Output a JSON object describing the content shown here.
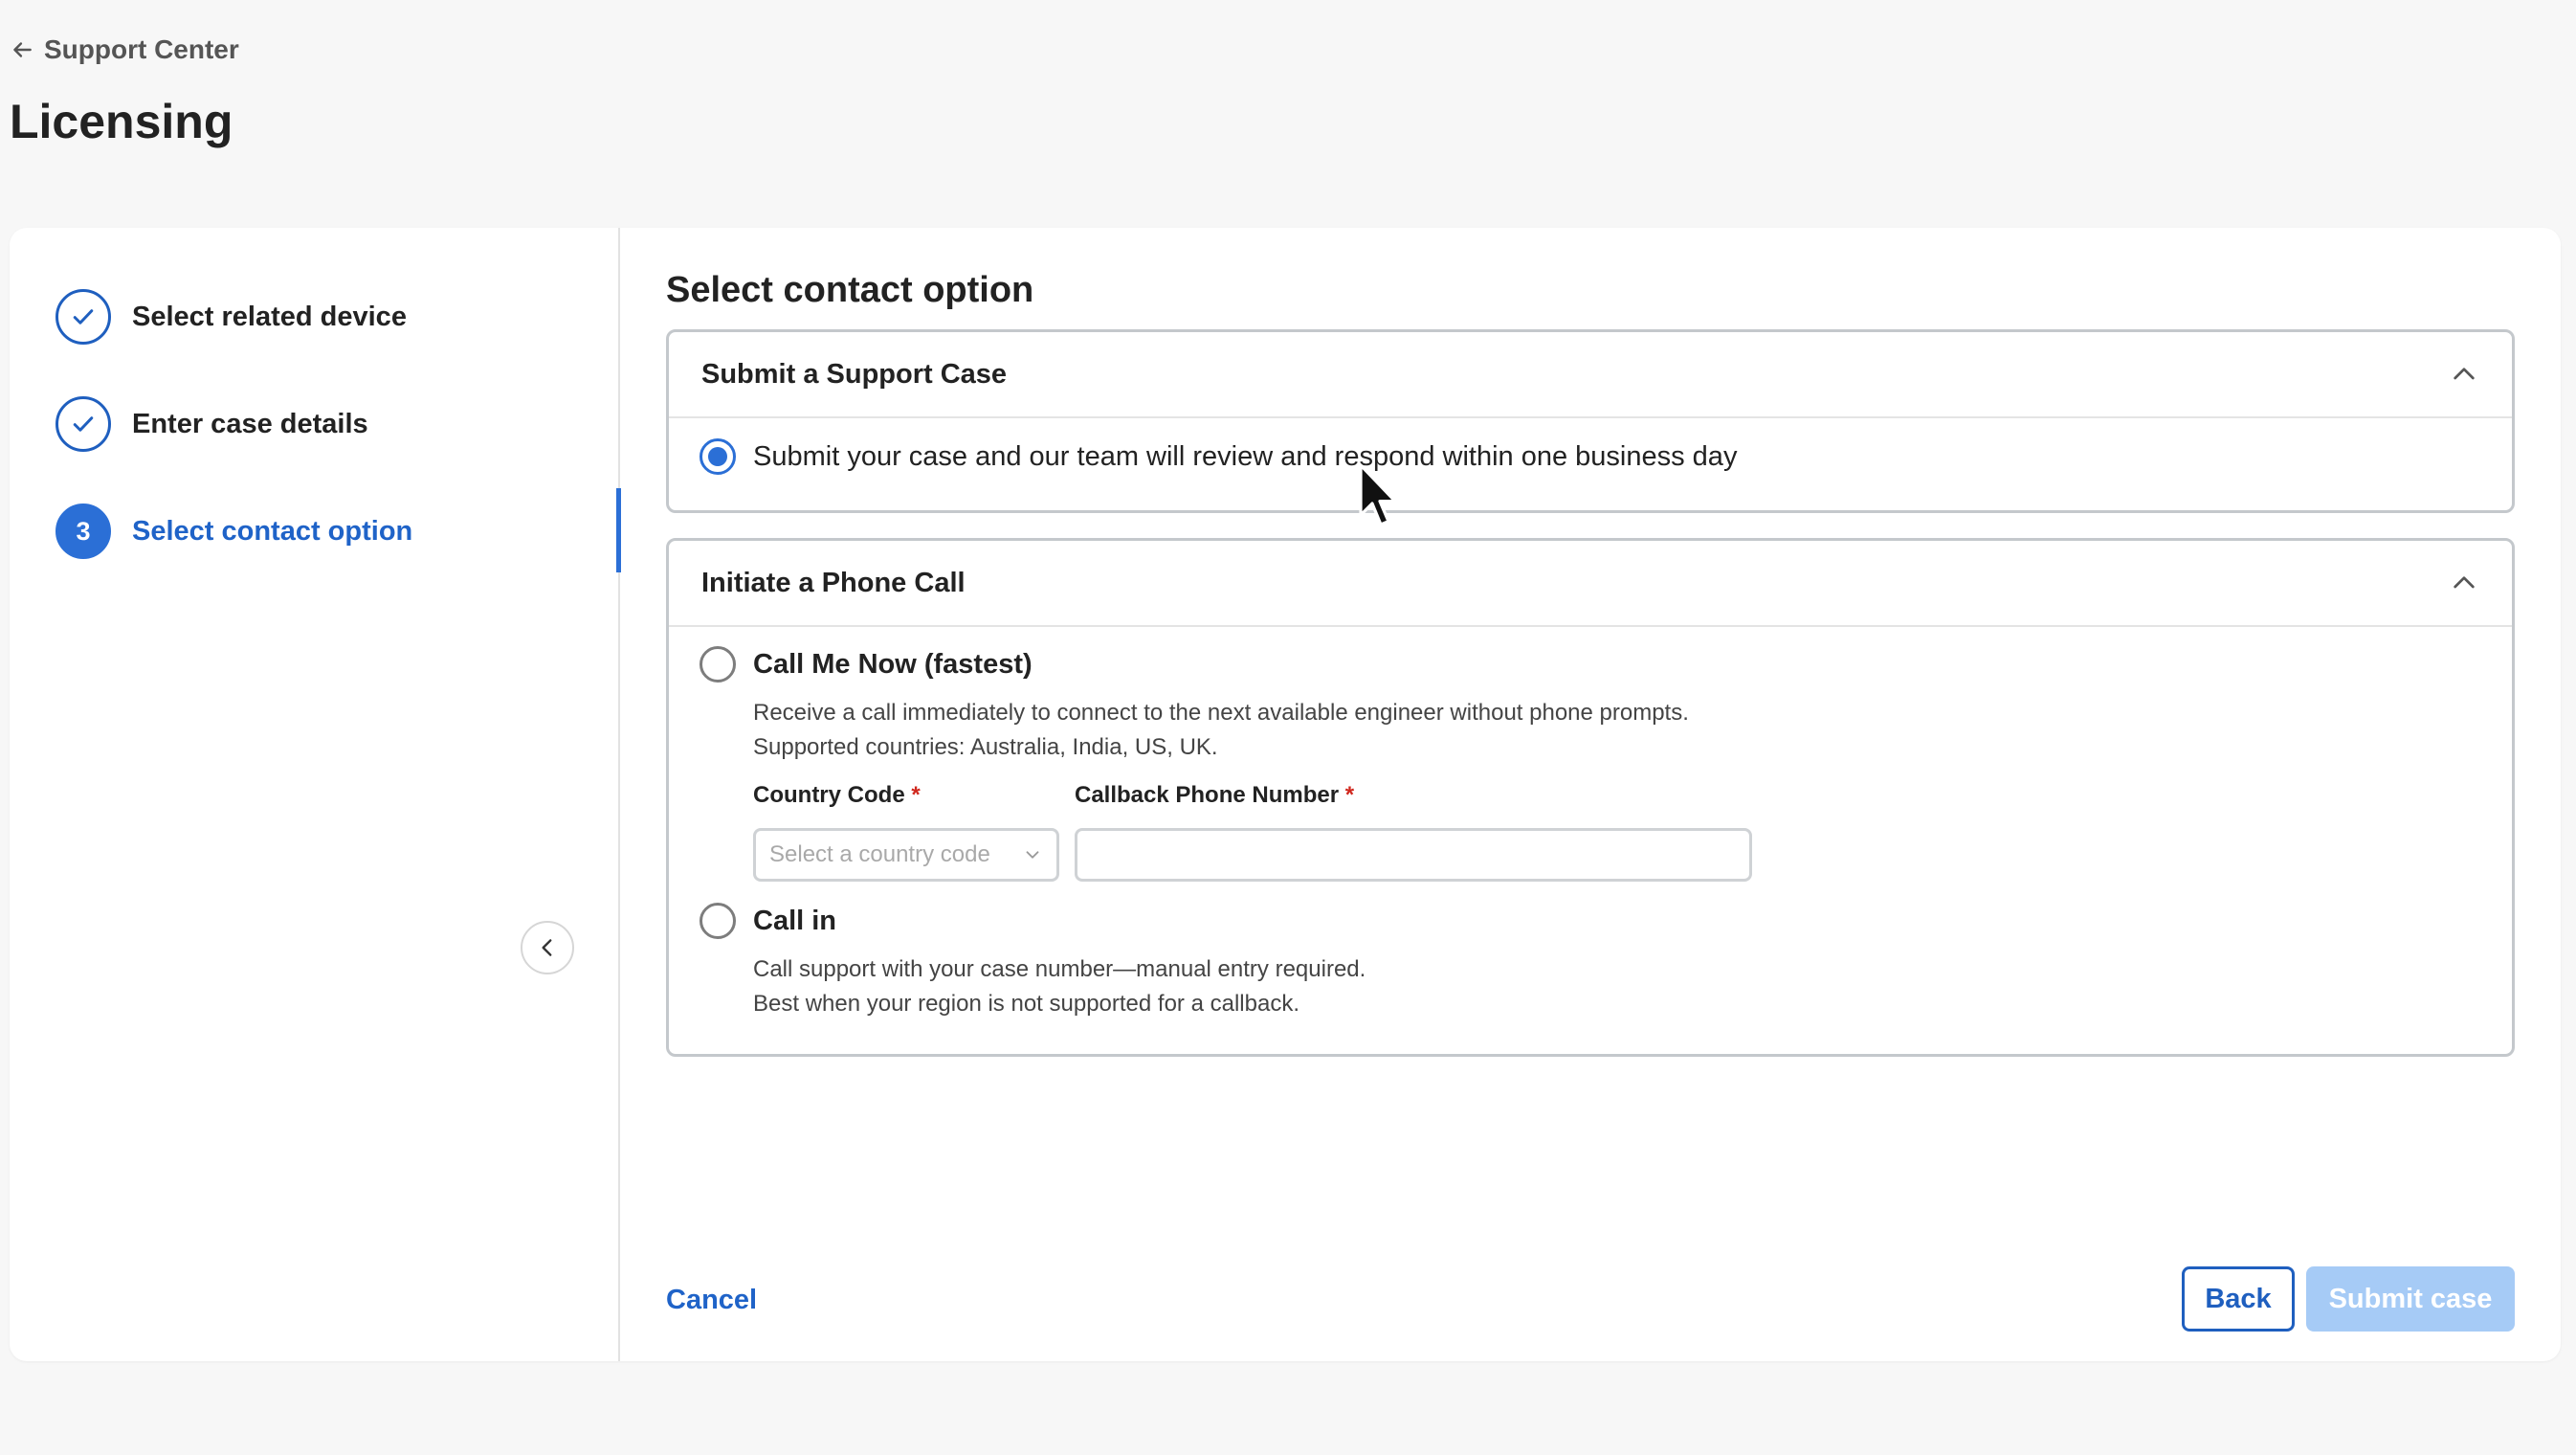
{
  "header": {
    "breadcrumb": "Support Center",
    "title": "Licensing"
  },
  "sidebar": {
    "steps": [
      {
        "label": "Select related device",
        "state": "complete"
      },
      {
        "label": "Enter case details",
        "state": "complete"
      },
      {
        "label": "Select contact option",
        "state": "active",
        "number": "3"
      }
    ]
  },
  "main": {
    "title": "Select contact option",
    "support_case": {
      "header": "Submit a Support Case",
      "option_label": "Submit your case and our team will review and respond within one business day",
      "selected": true
    },
    "phone_call": {
      "header": "Initiate a Phone Call",
      "call_me_now": {
        "label": "Call Me Now (fastest)",
        "desc_line1": "Receive a call immediately to connect to the next available engineer without phone prompts.",
        "desc_line2": "Supported countries: Australia, India, US, UK."
      },
      "country_code": {
        "label": "Country Code",
        "required_mark": "*",
        "placeholder": "Select a country code"
      },
      "callback_phone": {
        "label": "Callback Phone Number",
        "required_mark": "*",
        "value": ""
      },
      "call_in": {
        "label": "Call in",
        "desc_line1": "Call support with your case number—manual entry required.",
        "desc_line2": "Best when your region is not supported for a callback."
      }
    }
  },
  "footer": {
    "cancel_label": "Cancel",
    "back_label": "Back",
    "submit_label": "Submit case"
  },
  "colors": {
    "accent": "#2b6fd6",
    "link": "#1f63c8",
    "submit_disabled": "#a6cbf6",
    "required": "#d0271d"
  }
}
